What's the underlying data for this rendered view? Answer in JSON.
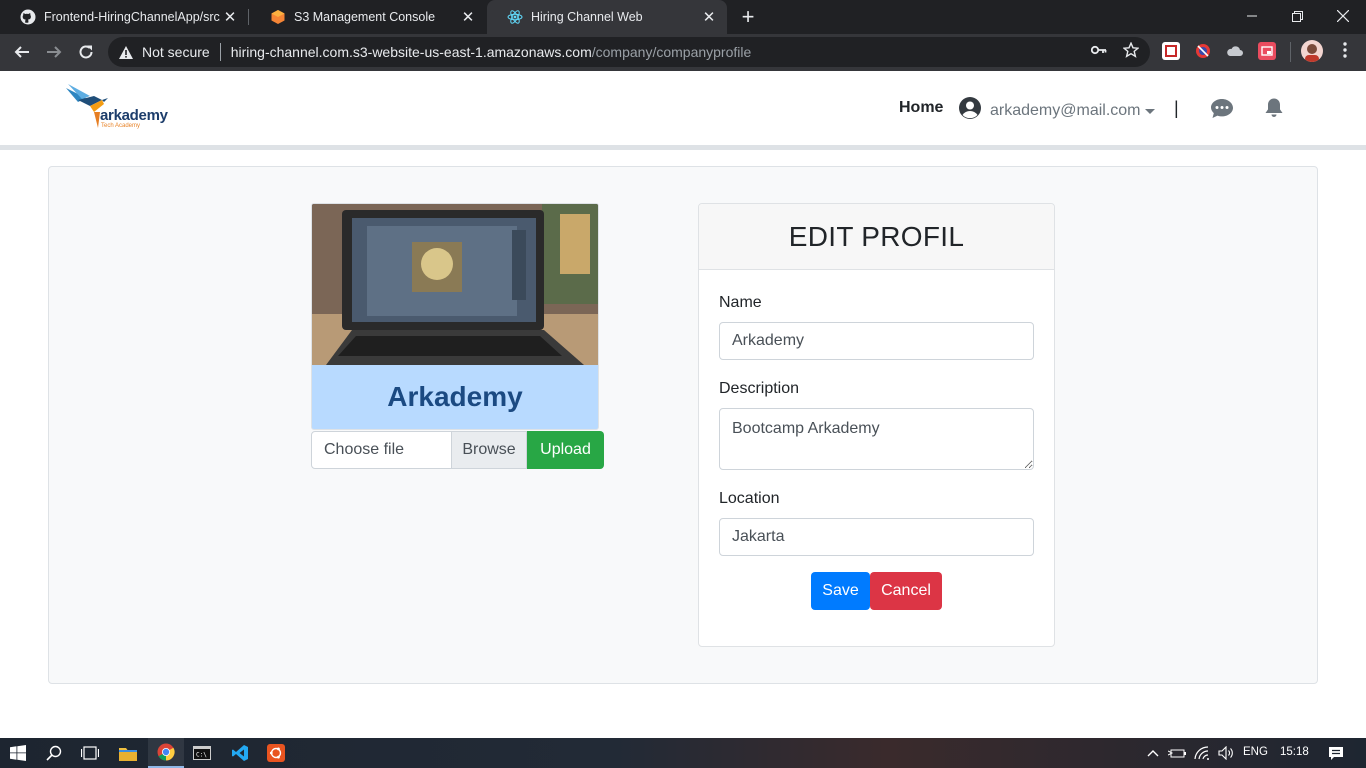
{
  "browser": {
    "tabs": [
      {
        "title": "Frontend-HiringChannelApp/src/",
        "icon": "github-icon"
      },
      {
        "title": "S3 Management Console",
        "icon": "aws-icon"
      },
      {
        "title": "Hiring Channel Web",
        "icon": "react-icon"
      }
    ],
    "security_label": "Not secure",
    "url_host": "hiring-channel.com.s3-website-us-east-1.amazonaws.com",
    "url_path": "/company/companyprofile"
  },
  "header": {
    "logo_brand": "arkademy",
    "logo_tagline": "Tech Academy",
    "nav_home": "Home",
    "user_email": "arkademy@mail.com",
    "separator": "|"
  },
  "profile": {
    "company_name": "Arkademy",
    "file_placeholder": "Choose file",
    "browse_label": "Browse",
    "upload_label": "Upload"
  },
  "edit_form": {
    "title": "EDIT PROFIL",
    "name_label": "Name",
    "name_value": "Arkademy",
    "description_label": "Description",
    "description_value": "Bootcamp Arkademy",
    "location_label": "Location",
    "location_value": "Jakarta",
    "save_label": "Save",
    "cancel_label": "Cancel"
  },
  "taskbar": {
    "language": "ENG",
    "time": "15:18"
  },
  "colors": {
    "primary": "#007bff",
    "success": "#28a745",
    "danger": "#dc3545",
    "company_name": "#1b4a82",
    "company_bg": "#b8daff"
  }
}
